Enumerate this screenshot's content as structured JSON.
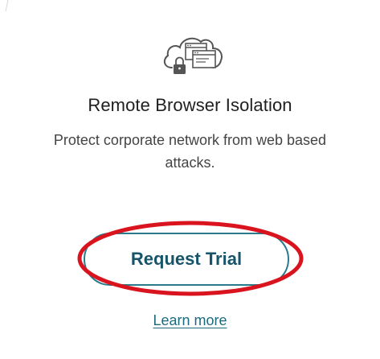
{
  "card": {
    "title": "Remote Browser Isolation",
    "description": "Protect corporate network from web based attacks.",
    "description_lines": [
      "Protect corporate network from web based",
      "attacks."
    ],
    "primary_button": "Request Trial",
    "link": "Learn more",
    "icon": "cloud-browser-lock-icon"
  },
  "colors": {
    "button_border": "#2a7b8c",
    "button_text": "#17546a",
    "link": "#1d6a7c",
    "annotation": "#d9141e"
  }
}
